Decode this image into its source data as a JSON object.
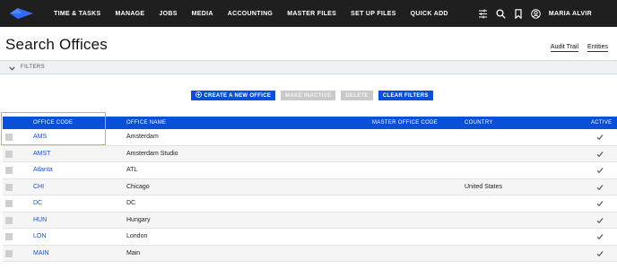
{
  "nav": {
    "items": [
      "TIME & TASKS",
      "MANAGE",
      "JOBS",
      "MEDIA",
      "ACCOUNTING",
      "MASTER FILES",
      "SET UP FILES",
      "QUICK ADD"
    ],
    "user_name": "MARIA ALVIR",
    "logo_icon": "diamond-logo-icon"
  },
  "page": {
    "title": "Search Offices",
    "audit_trail": "Audit Trail",
    "entities": "Entities"
  },
  "filters": {
    "label": "FILTERS"
  },
  "actions": {
    "create": "CREATE A NEW OFFICE",
    "make_inactive": "MAKE INACTIVE",
    "delete": "DELETE",
    "clear_filters": "CLEAR FILTERS"
  },
  "table": {
    "columns": [
      "OFFICE CODE",
      "OFFICE NAME",
      "MASTER OFFICE CODE",
      "COUNTRY",
      "ACTIVE"
    ],
    "rows": [
      {
        "code": "AMS",
        "name": "Amsterdam",
        "master": "",
        "country": "",
        "active": true
      },
      {
        "code": "AMST",
        "name": "Amsterdam Studio",
        "master": "",
        "country": "",
        "active": true
      },
      {
        "code": "Atlanta",
        "name": "ATL",
        "master": "",
        "country": "",
        "active": true
      },
      {
        "code": "CHI",
        "name": "Chicago",
        "master": "",
        "country": "United States",
        "active": true
      },
      {
        "code": "DC",
        "name": "DC",
        "master": "",
        "country": "",
        "active": true
      },
      {
        "code": "HUN",
        "name": "Hungary",
        "master": "",
        "country": "",
        "active": true
      },
      {
        "code": "LON",
        "name": "London",
        "master": "",
        "country": "",
        "active": true
      },
      {
        "code": "MAIN",
        "name": "Main",
        "master": "",
        "country": "",
        "active": true
      }
    ]
  },
  "colors": {
    "accent": "#0a4fd8",
    "topbar": "#1f1f1f",
    "highlight": "#f0a830"
  }
}
